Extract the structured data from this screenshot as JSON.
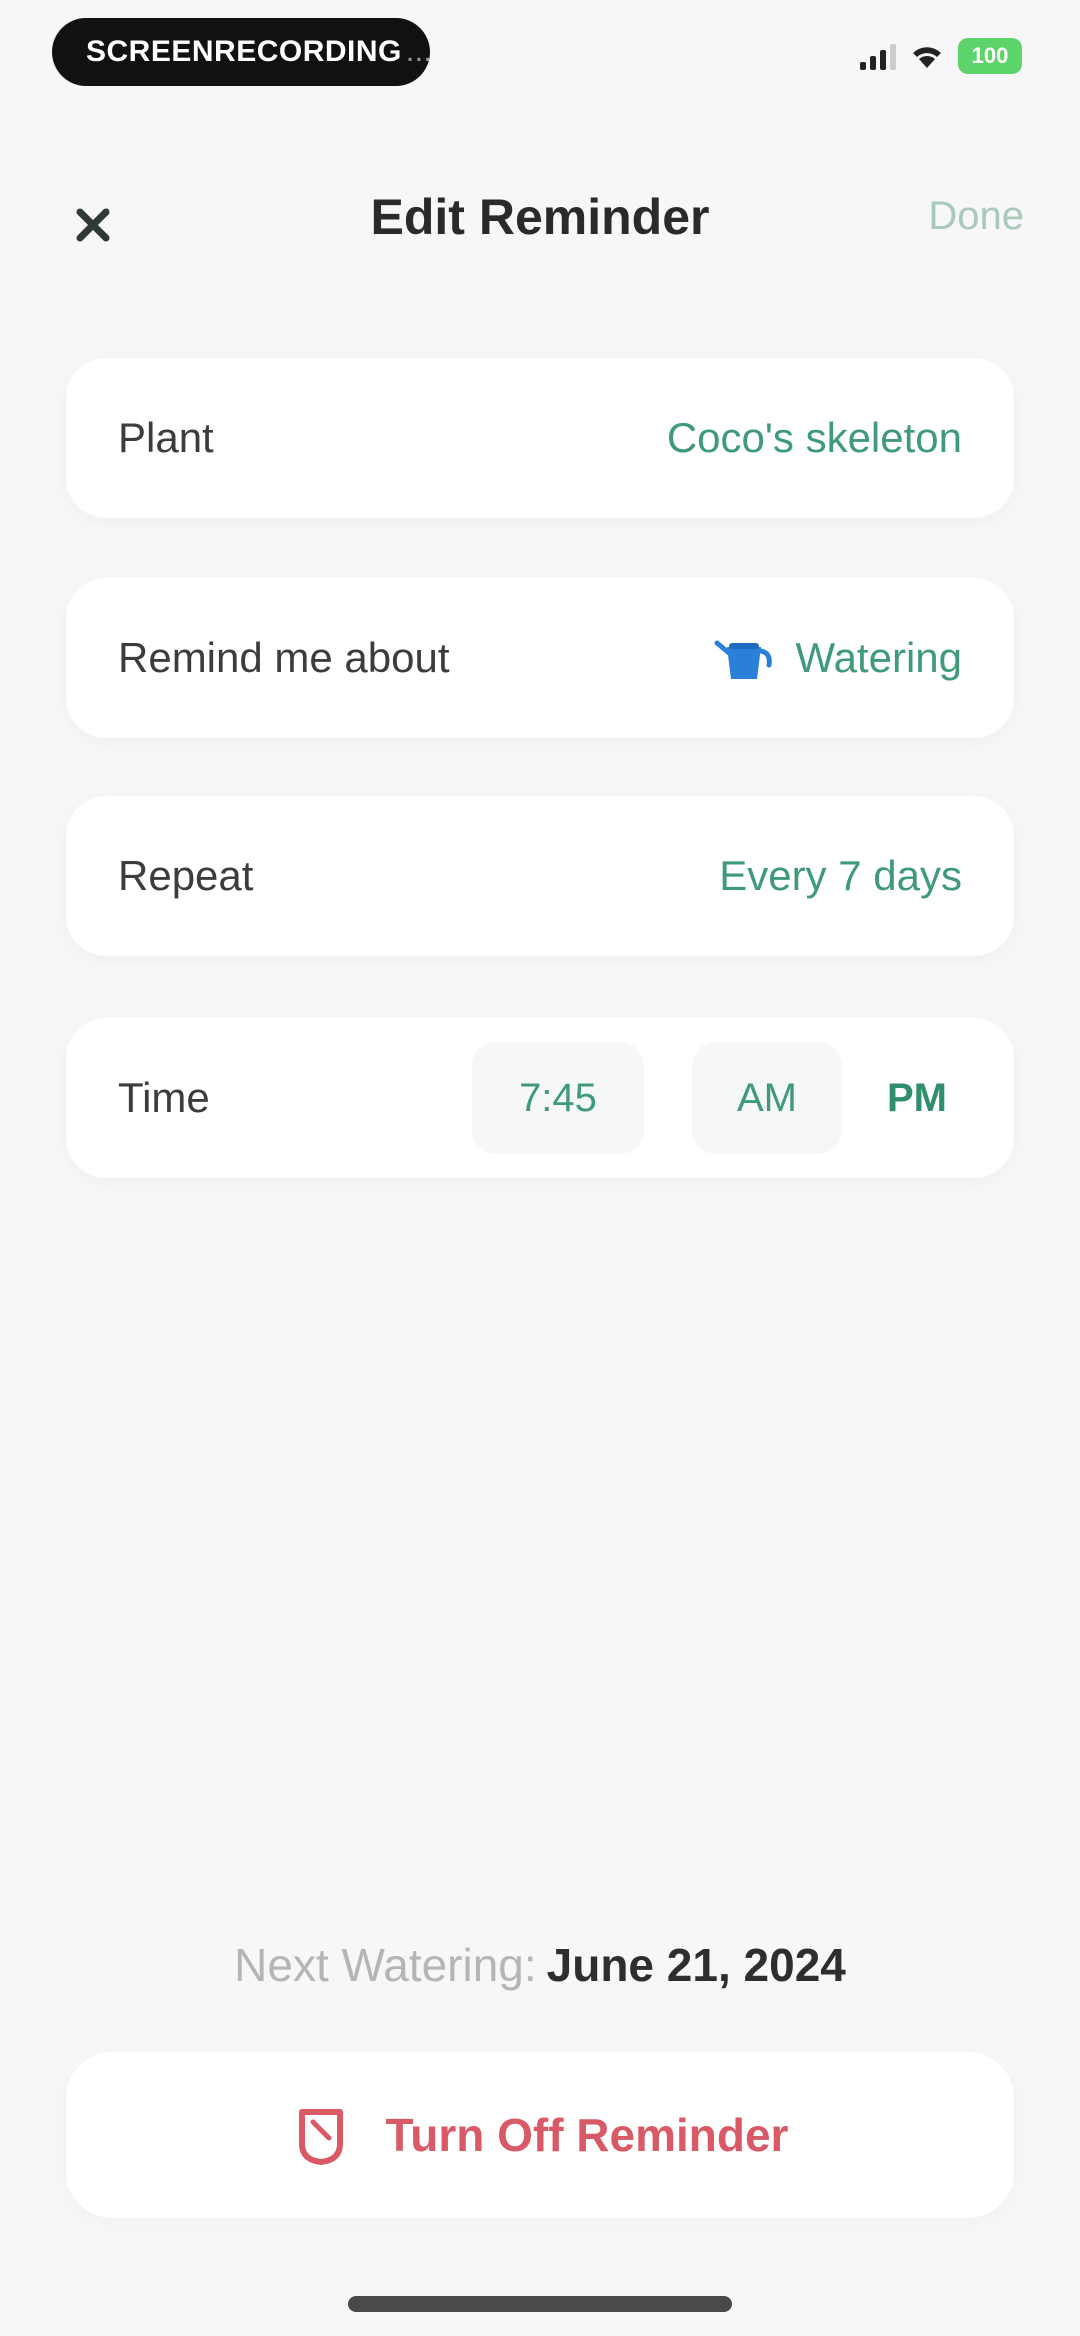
{
  "status_bar": {
    "recording_label": "SCREENRECORDING",
    "recording_suffix": "...",
    "battery": "100"
  },
  "nav": {
    "title": "Edit Reminder",
    "done_label": "Done"
  },
  "rows": {
    "plant": {
      "label": "Plant",
      "value": "Coco's skeleton"
    },
    "remind": {
      "label": "Remind me about",
      "value": "Watering",
      "icon": "watering-can-icon"
    },
    "repeat": {
      "label": "Repeat",
      "value": "Every 7 days"
    },
    "time": {
      "label": "Time",
      "value": "7:45",
      "am": "AM",
      "pm": "PM",
      "selected": "PM"
    }
  },
  "footer": {
    "next_label": "Next Watering:",
    "next_date": "June 21, 2024",
    "turn_off_label": "Turn Off Reminder"
  },
  "colors": {
    "accent": "#3f9a77",
    "danger": "#d95a66",
    "background": "#f7f7f9"
  }
}
